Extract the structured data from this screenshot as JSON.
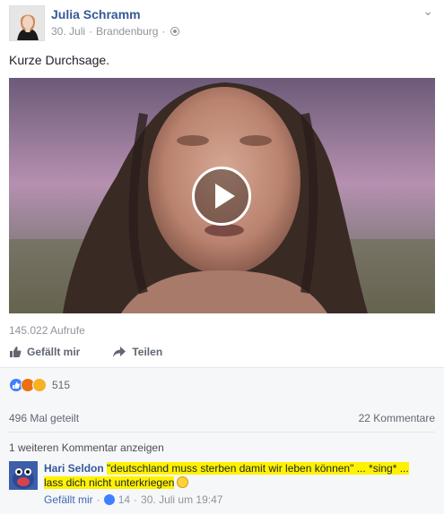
{
  "post": {
    "author": "Julia Schramm",
    "date": "30. Juli",
    "separator": "·",
    "location": "Brandenburg",
    "privacy_icon": "globe-icon",
    "text": "Kurze Durchsage.",
    "video": {
      "views": "145.022 Aufrufe"
    }
  },
  "actions": {
    "like": "Gefällt mir",
    "share": "Teilen"
  },
  "feedback": {
    "reaction_count": "515",
    "shares": "496 Mal geteilt",
    "comments": "22 Kommentare",
    "more_comments": "1 weiteren Kommentar anzeigen"
  },
  "comment": {
    "author": "Hari Seldon",
    "text_line1": "\"deutschland muss sterben damit wir leben können\" ... *sing* ...",
    "text_line2": "lass dich nicht unterkriegen",
    "like_label": "Gefällt mir",
    "dot": "·",
    "like_count": "14",
    "timestamp": "30. Juli um 19:47"
  },
  "colors": {
    "link_blue": "#365899",
    "highlight": "#fff200",
    "feedback_bg": "#f6f7f9"
  }
}
